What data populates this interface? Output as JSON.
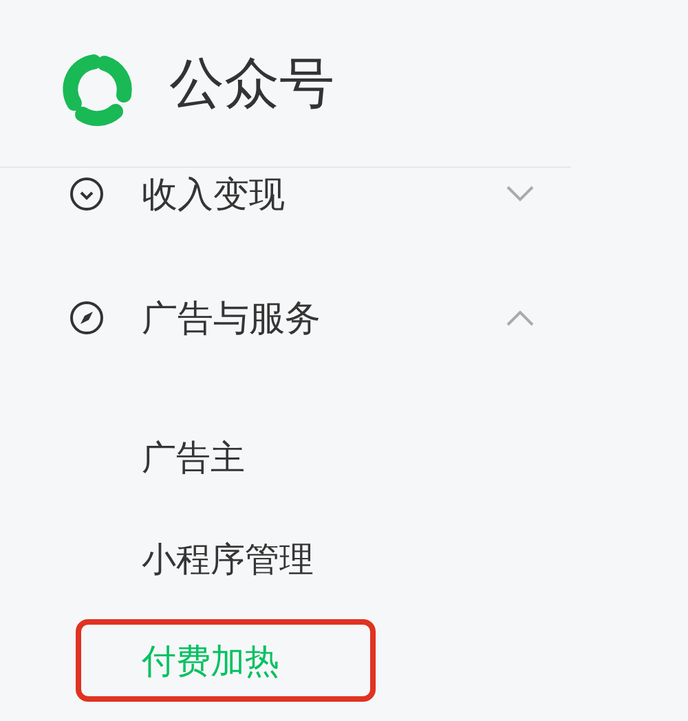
{
  "header": {
    "title": "公众号"
  },
  "menu": [
    {
      "label": "收入变现",
      "expanded": false
    },
    {
      "label": "广告与服务",
      "expanded": true,
      "children": [
        {
          "label": "广告主",
          "selected": false,
          "highlighted": false
        },
        {
          "label": "小程序管理",
          "selected": false,
          "highlighted": false
        },
        {
          "label": "付费加热",
          "selected": true,
          "highlighted": true
        }
      ]
    }
  ]
}
